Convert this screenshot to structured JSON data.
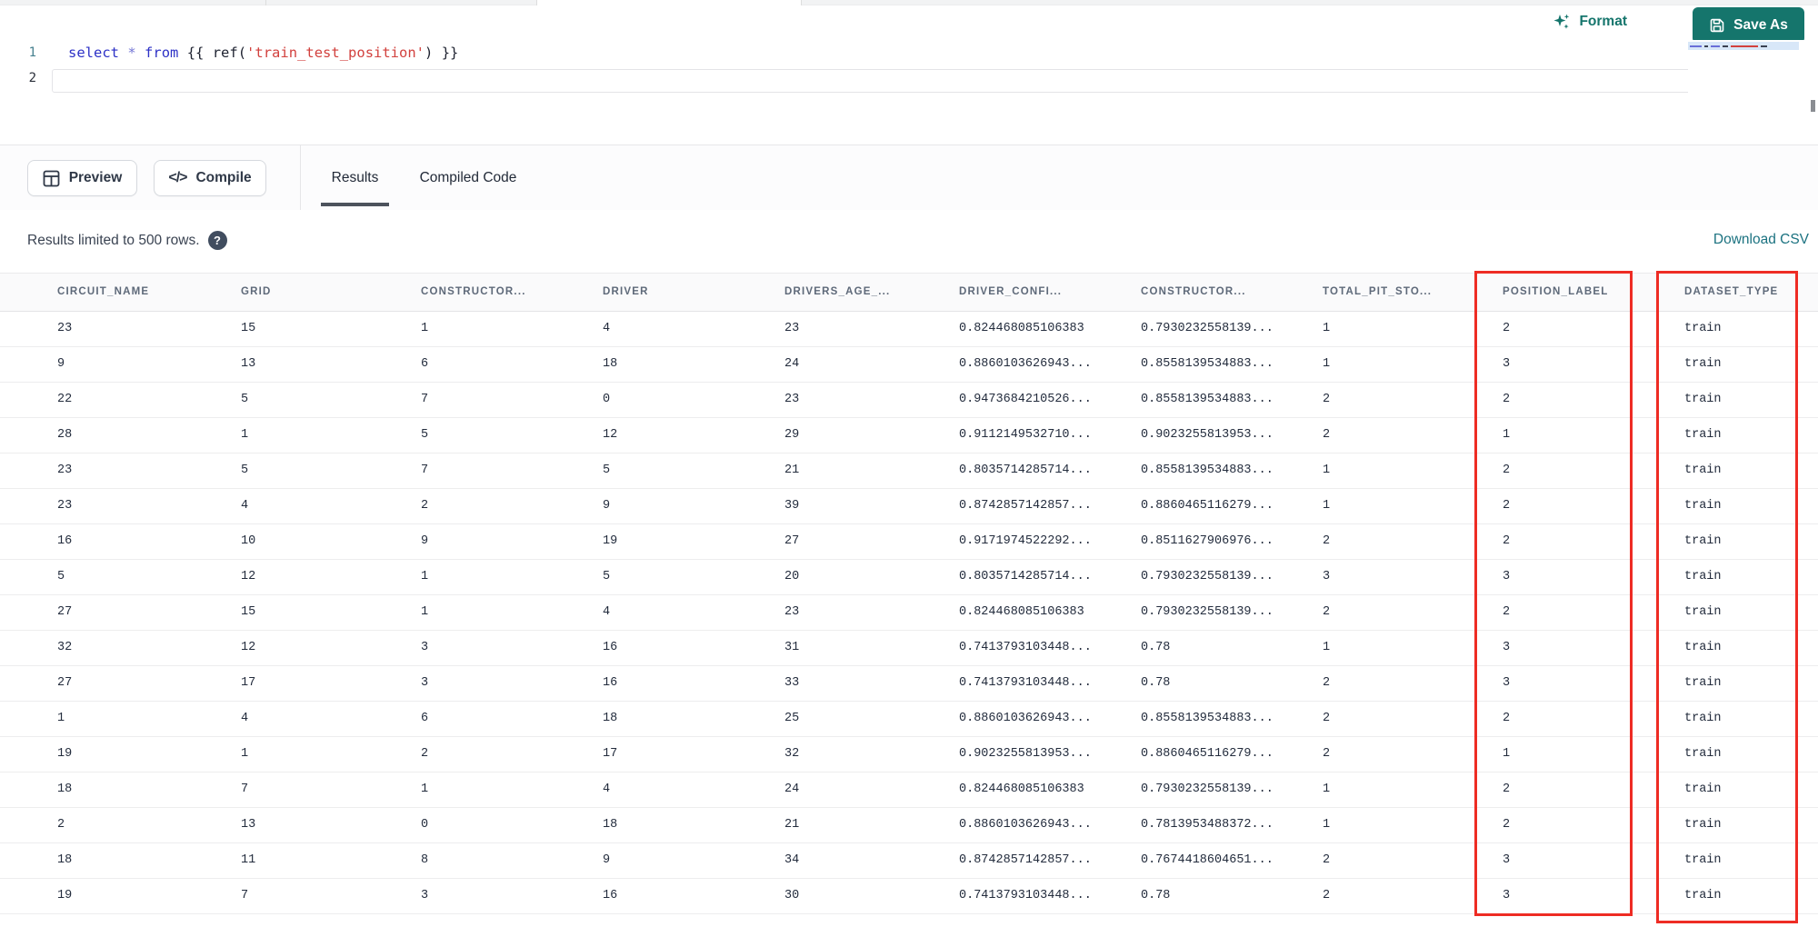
{
  "topbar": {
    "format_label": "Format",
    "save_as_label": "Save As"
  },
  "editor": {
    "line_numbers": [
      "1",
      "2"
    ],
    "code_tokens": [
      {
        "text": "select"
      },
      {
        "text": " "
      },
      {
        "text": "*"
      },
      {
        "text": " "
      },
      {
        "text": "from"
      },
      {
        "text": " "
      },
      {
        "text": "{{ "
      },
      {
        "text": "ref"
      },
      {
        "text": "("
      },
      {
        "text": "'train_test_position'"
      },
      {
        "text": ")"
      },
      {
        "text": " }}"
      }
    ]
  },
  "actions": {
    "preview_label": "Preview",
    "compile_label": "Compile"
  },
  "tabs": [
    {
      "label": "Results",
      "active": true
    },
    {
      "label": "Compiled Code",
      "active": false
    }
  ],
  "results_bar": {
    "note": "Results limited to 500 rows.",
    "help_glyph": "?",
    "download_label": "Download CSV"
  },
  "table": {
    "columns": [
      "CIRCUIT_NAME",
      "GRID",
      "CONSTRUCTOR...",
      "DRIVER",
      "DRIVERS_AGE_...",
      "DRIVER_CONFI...",
      "CONSTRUCTOR...",
      "TOTAL_PIT_STO...",
      "POSITION_LABEL",
      "DATASET_TYPE"
    ],
    "highlighted_columns": [
      "POSITION_LABEL",
      "DATASET_TYPE"
    ],
    "rows": [
      [
        "23",
        "15",
        "1",
        "4",
        "23",
        "0.824468085106383",
        "0.7930232558139...",
        "1",
        "2",
        "train"
      ],
      [
        "9",
        "13",
        "6",
        "18",
        "24",
        "0.8860103626943...",
        "0.8558139534883...",
        "1",
        "3",
        "train"
      ],
      [
        "22",
        "5",
        "7",
        "0",
        "23",
        "0.9473684210526...",
        "0.8558139534883...",
        "2",
        "2",
        "train"
      ],
      [
        "28",
        "1",
        "5",
        "12",
        "29",
        "0.9112149532710...",
        "0.9023255813953...",
        "2",
        "1",
        "train"
      ],
      [
        "23",
        "5",
        "7",
        "5",
        "21",
        "0.8035714285714...",
        "0.8558139534883...",
        "1",
        "2",
        "train"
      ],
      [
        "23",
        "4",
        "2",
        "9",
        "39",
        "0.8742857142857...",
        "0.8860465116279...",
        "1",
        "2",
        "train"
      ],
      [
        "16",
        "10",
        "9",
        "19",
        "27",
        "0.9171974522292...",
        "0.8511627906976...",
        "2",
        "2",
        "train"
      ],
      [
        "5",
        "12",
        "1",
        "5",
        "20",
        "0.8035714285714...",
        "0.7930232558139...",
        "3",
        "3",
        "train"
      ],
      [
        "27",
        "15",
        "1",
        "4",
        "23",
        "0.824468085106383",
        "0.7930232558139...",
        "2",
        "2",
        "train"
      ],
      [
        "32",
        "12",
        "3",
        "16",
        "31",
        "0.7413793103448...",
        "0.78",
        "1",
        "3",
        "train"
      ],
      [
        "27",
        "17",
        "3",
        "16",
        "33",
        "0.7413793103448...",
        "0.78",
        "2",
        "3",
        "train"
      ],
      [
        "1",
        "4",
        "6",
        "18",
        "25",
        "0.8860103626943...",
        "0.8558139534883...",
        "2",
        "2",
        "train"
      ],
      [
        "19",
        "1",
        "2",
        "17",
        "32",
        "0.9023255813953...",
        "0.8860465116279...",
        "2",
        "1",
        "train"
      ],
      [
        "18",
        "7",
        "1",
        "4",
        "24",
        "0.824468085106383",
        "0.7930232558139...",
        "1",
        "2",
        "train"
      ],
      [
        "2",
        "13",
        "0",
        "18",
        "21",
        "0.8860103626943...",
        "0.7813953488372...",
        "1",
        "2",
        "train"
      ],
      [
        "18",
        "11",
        "8",
        "9",
        "34",
        "0.8742857142857...",
        "0.7674418604651...",
        "2",
        "3",
        "train"
      ],
      [
        "19",
        "7",
        "3",
        "16",
        "30",
        "0.7413793103448...",
        "0.78",
        "2",
        "3",
        "train"
      ]
    ]
  },
  "colors": {
    "accent_teal": "#15756c",
    "highlight_red": "#ee2c24",
    "link_teal": "#1b7280",
    "code_keyword_blue": "#2d31c6",
    "code_string_red": "#d2413e",
    "header_text": "#5e6979"
  }
}
